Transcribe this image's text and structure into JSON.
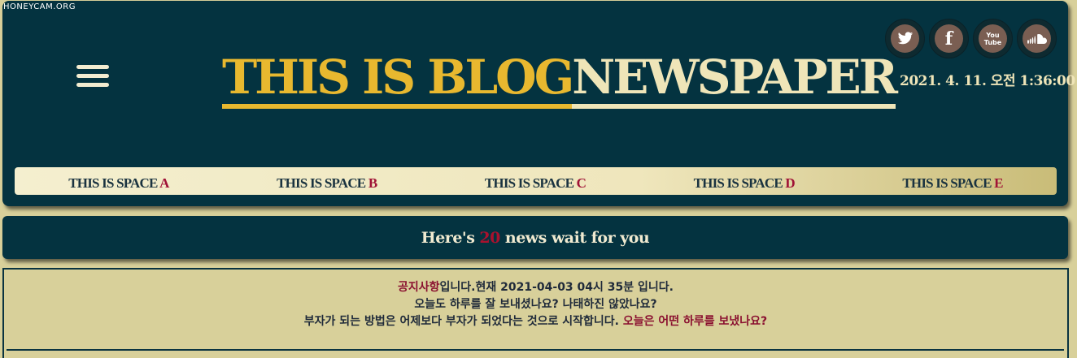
{
  "watermark": "HONEYCAM.ORG",
  "header": {
    "title_part_a": "THIS IS BLOG ",
    "title_part_b": "NEWSPAPER",
    "datetime": "2021. 4. 11. 오전 1:36:00",
    "menu_icon": "hamburger-menu-icon"
  },
  "socials": [
    {
      "name": "twitter",
      "glyph": "🐦"
    },
    {
      "name": "facebook",
      "glyph": "f"
    },
    {
      "name": "youtube",
      "glyph": "You Tube"
    },
    {
      "name": "soundcloud",
      "glyph": "☁"
    }
  ],
  "nav": [
    {
      "prefix": "THIS IS SPACE ",
      "letter": "A"
    },
    {
      "prefix": "THIS IS SPACE ",
      "letter": "B"
    },
    {
      "prefix": "THIS IS SPACE ",
      "letter": "C"
    },
    {
      "prefix": "THIS IS SPACE ",
      "letter": "D"
    },
    {
      "prefix": "THIS IS SPACE ",
      "letter": "E"
    }
  ],
  "banner": {
    "prefix": "Here's",
    "count": "20",
    "suffix": "news wait for you"
  },
  "notice": {
    "line1_highlight": "공지사항",
    "line1_rest": "입니다.현재 2021-04-03 04시 35분 입니다.",
    "line2": "오늘도 하루를 잘 보내셨나요? 나태하진 않았나요?",
    "line3_rest": "부자가 되는 방법은 어제보다 부자가 되었다는 것으로 시작합니다. ",
    "line3_highlight": "오늘은 어떤 하루를 보냈나요?"
  },
  "colors": {
    "header_bg": "#043340",
    "page_bg": "#d8d09a",
    "title_gold": "#e8b82f",
    "title_cream": "#efe5b8",
    "accent_red": "#a01236"
  }
}
